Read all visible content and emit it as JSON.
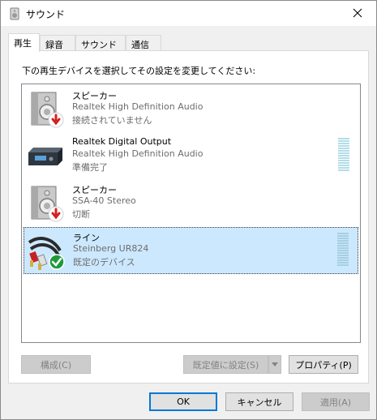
{
  "window": {
    "title": "サウンド"
  },
  "tabs": [
    {
      "label": "再生"
    },
    {
      "label": "録音"
    },
    {
      "label": "サウンド"
    },
    {
      "label": "通信"
    }
  ],
  "instruction": "下の再生デバイスを選択してその設定を変更してください:",
  "devices": [
    {
      "name": "スピーカー",
      "description": "Realtek High Definition Audio",
      "status": "接続されていません",
      "icon": "speaker-icon",
      "badge": "disconnected-badge-icon"
    },
    {
      "name": "Realtek Digital Output",
      "description": "Realtek High Definition Audio",
      "status": "準備完了",
      "icon": "receiver-icon"
    },
    {
      "name": "スピーカー",
      "description": "SSA-40 Stereo",
      "status": "切断",
      "icon": "speaker-icon",
      "badge": "disconnected-badge-icon"
    },
    {
      "name": "ライン",
      "description": "Steinberg UR824",
      "status": "既定のデバイス",
      "icon": "rca-cable-icon",
      "badge": "default-check-icon"
    }
  ],
  "buttons": {
    "configure": "構成(C)",
    "set_default": "既定値に設定(S)",
    "properties": "プロパティ(P)",
    "ok": "OK",
    "cancel": "キャンセル",
    "apply": "適用(A)"
  },
  "colors": {
    "selection": "#cce8ff",
    "accent": "#0078d7",
    "meter": "#b3dde8"
  }
}
